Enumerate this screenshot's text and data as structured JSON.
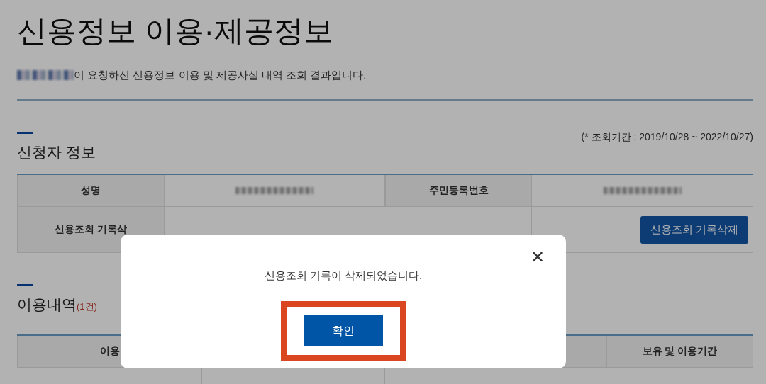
{
  "page": {
    "title": "신용정보 이용·제공정보",
    "intro": "이 요청하신 신용정보 이용 및 제공사실 내역 조회 결과입니다."
  },
  "applicant": {
    "heading": "신청자 정보",
    "period": "(* 조회기간 : 2019/10/28 ~ 2022/10/27)",
    "rows": [
      {
        "cells": [
          {
            "kind": "header",
            "text": "성명"
          },
          {
            "kind": "redacted"
          },
          {
            "kind": "header",
            "text": "주민등록번호"
          },
          {
            "kind": "redacted"
          }
        ]
      },
      {
        "cells": [
          {
            "kind": "header",
            "text": "신용조회 기록삭"
          },
          {
            "kind": "wide"
          },
          {
            "kind": "button",
            "text": "신용조회 기록삭제"
          }
        ]
      }
    ]
  },
  "usage": {
    "heading": "이용내역",
    "count": "(1건)",
    "columns": [
      "이용",
      "보유 및 이용기간"
    ]
  },
  "dialog": {
    "message": "신용조회 기록이 삭제되었습니다.",
    "confirm": "확인",
    "close": "✕",
    "highlighted": true
  }
}
